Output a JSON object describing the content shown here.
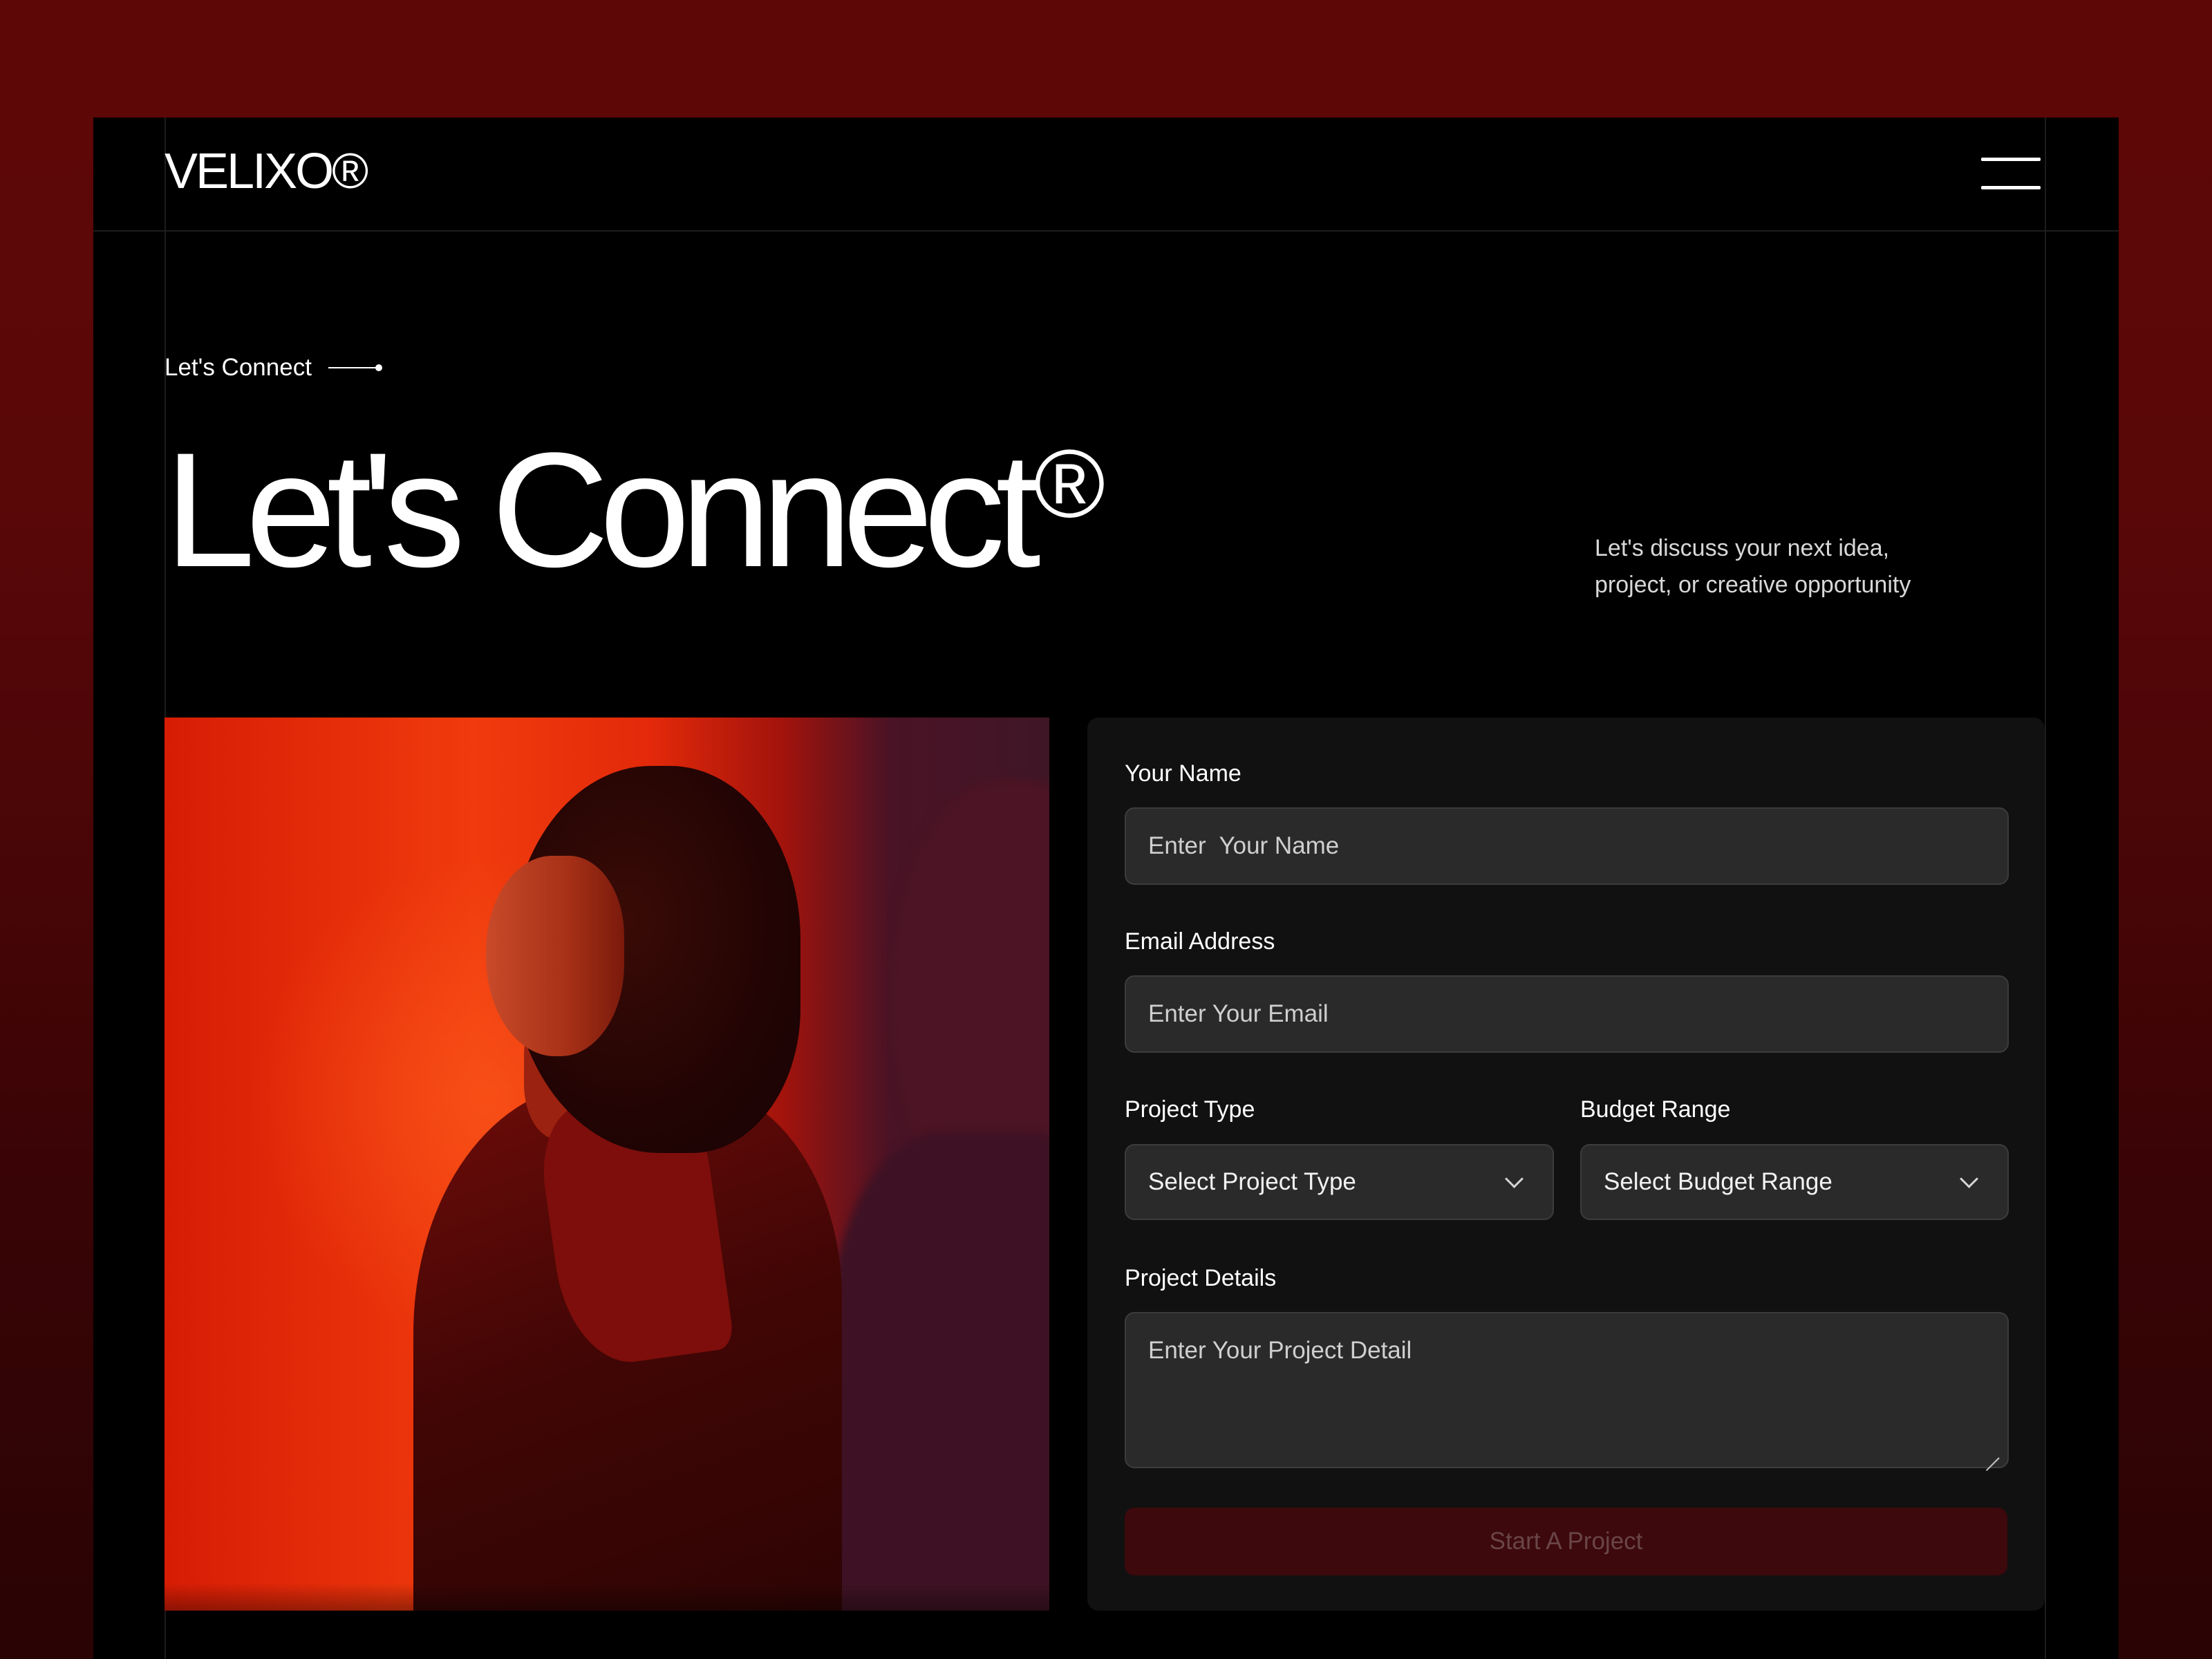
{
  "header": {
    "logo": "VELIXO®",
    "menu_icon": "hamburger-menu-icon"
  },
  "hero": {
    "eyebrow": "Let's Connect",
    "title": "Let's Connect",
    "title_mark": "®",
    "intro_line1": "Let's discuss your next idea,",
    "intro_line2": "project, or creative opportunity"
  },
  "photo": {
    "subject": "portrait-photo"
  },
  "form": {
    "name_label": "Your Name",
    "name_placeholder": "Enter  Your Name",
    "name_value": "",
    "email_label": "Email Address",
    "email_placeholder": "Enter Your Email",
    "email_value": "",
    "project_type_label": "Project Type",
    "project_type_value": "Select Project Type",
    "budget_label": "Budget Range",
    "budget_value": "Select Budget Range",
    "details_label": "Project Details",
    "details_placeholder": "Enter Your Project Detail",
    "details_value": "",
    "submit_label": "Start A Project"
  },
  "colors": {
    "background": "#5e0707",
    "panel": "#000000",
    "card": "#111111",
    "field": "#2a2a2a",
    "button": "#3d090c",
    "button_text": "#6a4548"
  }
}
